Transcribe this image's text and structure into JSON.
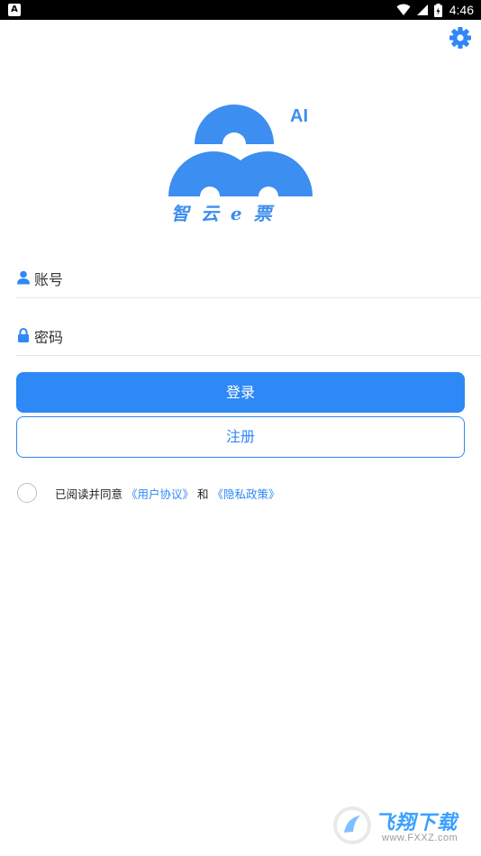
{
  "status_bar": {
    "time": "4:46",
    "left_icon": "A",
    "icons": [
      "wifi-icon",
      "signal-icon",
      "battery-icon"
    ]
  },
  "header": {
    "settings_icon": "gear-icon"
  },
  "logo": {
    "ai_label": "AI",
    "brand_name": "智 云 e 票"
  },
  "form": {
    "account_placeholder": "账号",
    "password_placeholder": "密码",
    "login_label": "登录",
    "register_label": "注册"
  },
  "agreement": {
    "prefix": "已阅读并同意",
    "user_agreement": "《用户协议》",
    "and": "和",
    "privacy_policy": "《隐私政策》"
  },
  "watermark": {
    "title": "飞翔下载",
    "url": "www.FXXZ.com"
  },
  "colors": {
    "primary": "#2e88f6",
    "logo_blue": "#3c8ef0",
    "status_bar": "#000000"
  }
}
